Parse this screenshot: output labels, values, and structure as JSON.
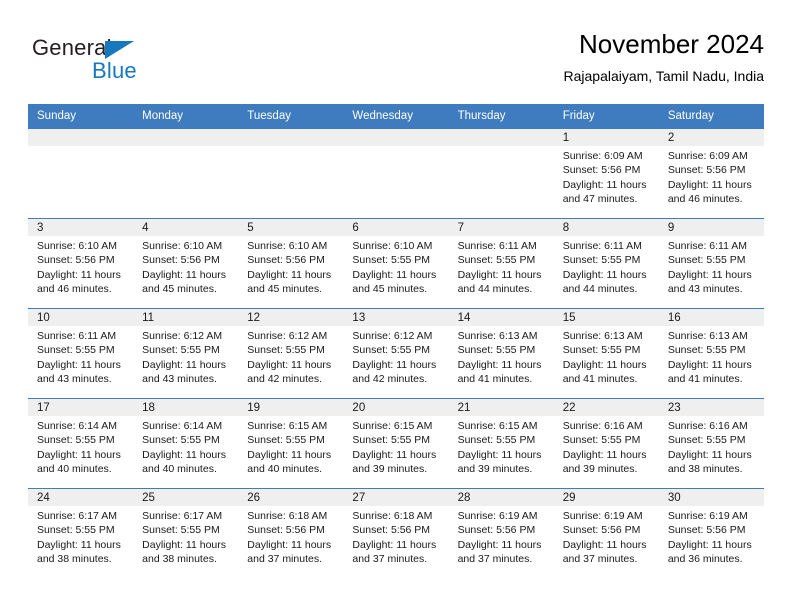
{
  "brand": {
    "name_part1": "General",
    "name_part2": "Blue",
    "triangle_icon": "blue-triangle-icon",
    "accent_color": "#1878be"
  },
  "header": {
    "title": "November 2024",
    "subtitle": "Rajapalaiyam, Tamil Nadu, India"
  },
  "theme": {
    "header_blue": "#3e7cbf",
    "day_strip_gray": "#efefef",
    "text_color": "#1a1a1a"
  },
  "weekdays": [
    "Sunday",
    "Monday",
    "Tuesday",
    "Wednesday",
    "Thursday",
    "Friday",
    "Saturday"
  ],
  "weeks": [
    [
      {
        "day": "",
        "empty": true
      },
      {
        "day": "",
        "empty": true
      },
      {
        "day": "",
        "empty": true
      },
      {
        "day": "",
        "empty": true
      },
      {
        "day": "",
        "empty": true
      },
      {
        "day": "1",
        "sunrise": "Sunrise: 6:09 AM",
        "sunset": "Sunset: 5:56 PM",
        "daylight": "Daylight: 11 hours and 47 minutes."
      },
      {
        "day": "2",
        "sunrise": "Sunrise: 6:09 AM",
        "sunset": "Sunset: 5:56 PM",
        "daylight": "Daylight: 11 hours and 46 minutes."
      }
    ],
    [
      {
        "day": "3",
        "sunrise": "Sunrise: 6:10 AM",
        "sunset": "Sunset: 5:56 PM",
        "daylight": "Daylight: 11 hours and 46 minutes."
      },
      {
        "day": "4",
        "sunrise": "Sunrise: 6:10 AM",
        "sunset": "Sunset: 5:56 PM",
        "daylight": "Daylight: 11 hours and 45 minutes."
      },
      {
        "day": "5",
        "sunrise": "Sunrise: 6:10 AM",
        "sunset": "Sunset: 5:56 PM",
        "daylight": "Daylight: 11 hours and 45 minutes."
      },
      {
        "day": "6",
        "sunrise": "Sunrise: 6:10 AM",
        "sunset": "Sunset: 5:55 PM",
        "daylight": "Daylight: 11 hours and 45 minutes."
      },
      {
        "day": "7",
        "sunrise": "Sunrise: 6:11 AM",
        "sunset": "Sunset: 5:55 PM",
        "daylight": "Daylight: 11 hours and 44 minutes."
      },
      {
        "day": "8",
        "sunrise": "Sunrise: 6:11 AM",
        "sunset": "Sunset: 5:55 PM",
        "daylight": "Daylight: 11 hours and 44 minutes."
      },
      {
        "day": "9",
        "sunrise": "Sunrise: 6:11 AM",
        "sunset": "Sunset: 5:55 PM",
        "daylight": "Daylight: 11 hours and 43 minutes."
      }
    ],
    [
      {
        "day": "10",
        "sunrise": "Sunrise: 6:11 AM",
        "sunset": "Sunset: 5:55 PM",
        "daylight": "Daylight: 11 hours and 43 minutes."
      },
      {
        "day": "11",
        "sunrise": "Sunrise: 6:12 AM",
        "sunset": "Sunset: 5:55 PM",
        "daylight": "Daylight: 11 hours and 43 minutes."
      },
      {
        "day": "12",
        "sunrise": "Sunrise: 6:12 AM",
        "sunset": "Sunset: 5:55 PM",
        "daylight": "Daylight: 11 hours and 42 minutes."
      },
      {
        "day": "13",
        "sunrise": "Sunrise: 6:12 AM",
        "sunset": "Sunset: 5:55 PM",
        "daylight": "Daylight: 11 hours and 42 minutes."
      },
      {
        "day": "14",
        "sunrise": "Sunrise: 6:13 AM",
        "sunset": "Sunset: 5:55 PM",
        "daylight": "Daylight: 11 hours and 41 minutes."
      },
      {
        "day": "15",
        "sunrise": "Sunrise: 6:13 AM",
        "sunset": "Sunset: 5:55 PM",
        "daylight": "Daylight: 11 hours and 41 minutes."
      },
      {
        "day": "16",
        "sunrise": "Sunrise: 6:13 AM",
        "sunset": "Sunset: 5:55 PM",
        "daylight": "Daylight: 11 hours and 41 minutes."
      }
    ],
    [
      {
        "day": "17",
        "sunrise": "Sunrise: 6:14 AM",
        "sunset": "Sunset: 5:55 PM",
        "daylight": "Daylight: 11 hours and 40 minutes."
      },
      {
        "day": "18",
        "sunrise": "Sunrise: 6:14 AM",
        "sunset": "Sunset: 5:55 PM",
        "daylight": "Daylight: 11 hours and 40 minutes."
      },
      {
        "day": "19",
        "sunrise": "Sunrise: 6:15 AM",
        "sunset": "Sunset: 5:55 PM",
        "daylight": "Daylight: 11 hours and 40 minutes."
      },
      {
        "day": "20",
        "sunrise": "Sunrise: 6:15 AM",
        "sunset": "Sunset: 5:55 PM",
        "daylight": "Daylight: 11 hours and 39 minutes."
      },
      {
        "day": "21",
        "sunrise": "Sunrise: 6:15 AM",
        "sunset": "Sunset: 5:55 PM",
        "daylight": "Daylight: 11 hours and 39 minutes."
      },
      {
        "day": "22",
        "sunrise": "Sunrise: 6:16 AM",
        "sunset": "Sunset: 5:55 PM",
        "daylight": "Daylight: 11 hours and 39 minutes."
      },
      {
        "day": "23",
        "sunrise": "Sunrise: 6:16 AM",
        "sunset": "Sunset: 5:55 PM",
        "daylight": "Daylight: 11 hours and 38 minutes."
      }
    ],
    [
      {
        "day": "24",
        "sunrise": "Sunrise: 6:17 AM",
        "sunset": "Sunset: 5:55 PM",
        "daylight": "Daylight: 11 hours and 38 minutes."
      },
      {
        "day": "25",
        "sunrise": "Sunrise: 6:17 AM",
        "sunset": "Sunset: 5:55 PM",
        "daylight": "Daylight: 11 hours and 38 minutes."
      },
      {
        "day": "26",
        "sunrise": "Sunrise: 6:18 AM",
        "sunset": "Sunset: 5:56 PM",
        "daylight": "Daylight: 11 hours and 37 minutes."
      },
      {
        "day": "27",
        "sunrise": "Sunrise: 6:18 AM",
        "sunset": "Sunset: 5:56 PM",
        "daylight": "Daylight: 11 hours and 37 minutes."
      },
      {
        "day": "28",
        "sunrise": "Sunrise: 6:19 AM",
        "sunset": "Sunset: 5:56 PM",
        "daylight": "Daylight: 11 hours and 37 minutes."
      },
      {
        "day": "29",
        "sunrise": "Sunrise: 6:19 AM",
        "sunset": "Sunset: 5:56 PM",
        "daylight": "Daylight: 11 hours and 37 minutes."
      },
      {
        "day": "30",
        "sunrise": "Sunrise: 6:19 AM",
        "sunset": "Sunset: 5:56 PM",
        "daylight": "Daylight: 11 hours and 36 minutes."
      }
    ]
  ]
}
